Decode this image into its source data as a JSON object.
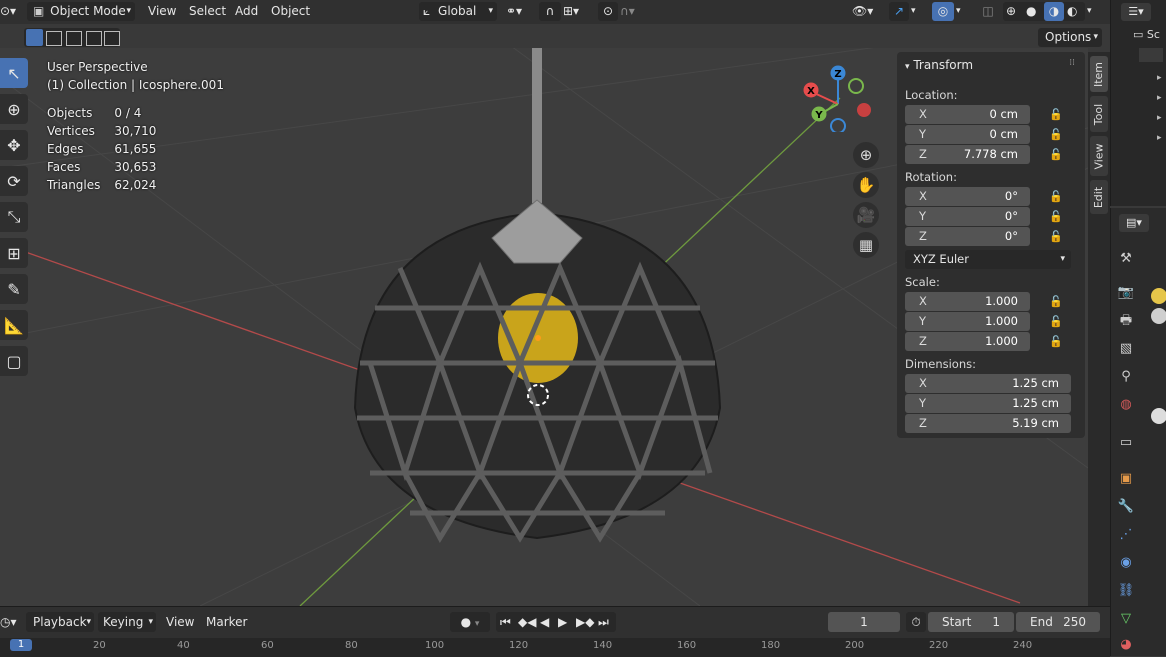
{
  "header": {
    "mode": "Object Mode",
    "menus": [
      "View",
      "Select",
      "Add",
      "Object"
    ],
    "orientation": "Global",
    "options": "Options"
  },
  "overlay": {
    "view_name": "User Perspective",
    "collection": "(1) Collection | Icosphere.001",
    "stats": [
      {
        "label": "Objects",
        "value": "0 / 4"
      },
      {
        "label": "Vertices",
        "value": "30,710"
      },
      {
        "label": "Edges",
        "value": "61,655"
      },
      {
        "label": "Faces",
        "value": "30,653"
      },
      {
        "label": "Triangles",
        "value": "62,024"
      }
    ]
  },
  "gizmo": {
    "x": "X",
    "y": "Y",
    "z": "Z"
  },
  "npanel": {
    "title": "Transform",
    "location_label": "Location:",
    "location": [
      {
        "axis": "X",
        "value": "0 cm"
      },
      {
        "axis": "Y",
        "value": "0 cm"
      },
      {
        "axis": "Z",
        "value": "7.778 cm"
      }
    ],
    "rotation_label": "Rotation:",
    "rotation": [
      {
        "axis": "X",
        "value": "0°"
      },
      {
        "axis": "Y",
        "value": "0°"
      },
      {
        "axis": "Z",
        "value": "0°"
      }
    ],
    "rotation_mode": "XYZ Euler",
    "scale_label": "Scale:",
    "scale": [
      {
        "axis": "X",
        "value": "1.000"
      },
      {
        "axis": "Y",
        "value": "1.000"
      },
      {
        "axis": "Z",
        "value": "1.000"
      }
    ],
    "dimensions_label": "Dimensions:",
    "dimensions": [
      {
        "axis": "X",
        "value": "1.25 cm"
      },
      {
        "axis": "Y",
        "value": "1.25 cm"
      },
      {
        "axis": "Z",
        "value": "5.19 cm"
      }
    ]
  },
  "sidetabs": [
    "Item",
    "Tool",
    "View",
    "Edit"
  ],
  "outliner": {
    "label": "Sc"
  },
  "timeline": {
    "menus": [
      "Playback",
      "Keying",
      "View",
      "Marker"
    ],
    "current_frame": "1",
    "start_label": "Start",
    "start": "1",
    "end_label": "End",
    "end": "250",
    "ticks": [
      "1",
      "20",
      "40",
      "60",
      "80",
      "100",
      "120",
      "140",
      "160",
      "180",
      "200",
      "220",
      "240"
    ]
  },
  "colors": {
    "accent": "#4772b3",
    "x_axis": "#e64c4c",
    "y_axis": "#7ab84c",
    "z_axis": "#3b88d6"
  }
}
